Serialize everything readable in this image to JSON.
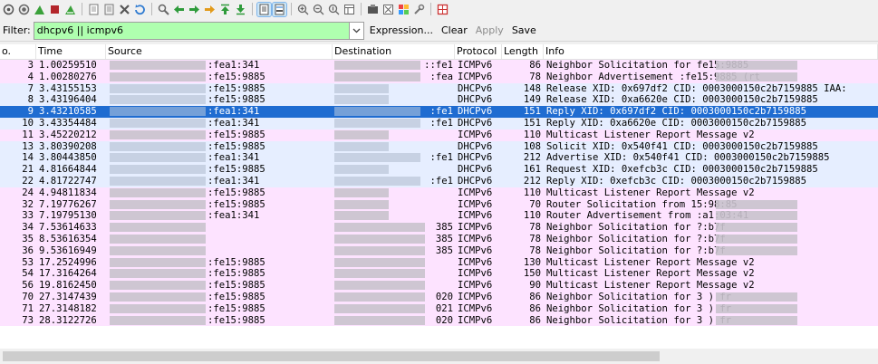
{
  "toolbar": {
    "icons": [
      "capture-options-icon",
      "restart-icon",
      "shark-fin-icon",
      "stop-icon",
      "shark-fin-reload-icon",
      "open-file-icon",
      "save-file-icon",
      "close-file-icon",
      "reload-icon",
      "find-icon",
      "go-back-icon",
      "go-forward-icon",
      "go-to-packet-icon",
      "go-first-icon",
      "go-last-icon",
      "autoscroll-icon",
      "colorize-icon",
      "zoom-in-icon",
      "zoom-out-icon",
      "zoom-normal-icon",
      "resize-columns-icon",
      "capture-filters-icon",
      "display-filters-icon",
      "coloring-rules-icon",
      "preferences-icon",
      "help-icon"
    ]
  },
  "filter": {
    "label": "Filter:",
    "value": "dhcpv6 || icmpv6",
    "expression": "Expression...",
    "clear": "Clear",
    "apply": "Apply",
    "save": "Save"
  },
  "columns": {
    "no": "o.",
    "time": "Time",
    "source": "Source",
    "destination": "Destination",
    "protocol": "Protocol",
    "length": "Length",
    "info": "Info"
  },
  "packets": [
    {
      "no": "3",
      "time": "1.00259510",
      "src": ":fea1:341",
      "dst": "::fe1",
      "proto": "ICMPv6",
      "len": "86",
      "info": "Neighbor Solicitation for                 fe15:9885",
      "color": "pink"
    },
    {
      "no": "4",
      "time": "1.00280276",
      "src": ":fe15:9885",
      "dst": ":fea",
      "proto": "ICMPv6",
      "len": "78",
      "info": "Neighbor Advertisement                   :fe15:9885 (rt",
      "color": "pink"
    },
    {
      "no": "7",
      "time": "3.43155153",
      "src": ":fe15:9885",
      "dst": "",
      "proto": "DHCPv6",
      "len": "148",
      "info": "Release XID: 0x697df2 CID: 0003000150c2b7159885 IAA:",
      "color": "blue"
    },
    {
      "no": "8",
      "time": "3.43196404",
      "src": ":fe15:9885",
      "dst": "",
      "proto": "DHCPv6",
      "len": "149",
      "info": "Release XID: 0xa6620e CID: 0003000150c2b7159885",
      "color": "blue"
    },
    {
      "no": "9",
      "time": "3.43210585",
      "src": ":fea1:341",
      "dst": ":fe1",
      "proto": "DHCPv6",
      "len": "151",
      "info": "Reply XID: 0x697df2 CID: 0003000150c2b7159885",
      "color": "sel"
    },
    {
      "no": "10",
      "time": "3.43354484",
      "src": ":fea1:341",
      "dst": ":fe1",
      "proto": "DHCPv6",
      "len": "151",
      "info": "Reply XID: 0xa6620e CID: 0003000150c2b7159885",
      "color": "blue"
    },
    {
      "no": "11",
      "time": "3.45220212",
      "src": ":fe15:9885",
      "dst": "",
      "proto": "ICMPv6",
      "len": "110",
      "info": "Multicast Listener Report Message v2",
      "color": "pink"
    },
    {
      "no": "13",
      "time": "3.80390208",
      "src": ":fe15:9885",
      "dst": "",
      "proto": "DHCPv6",
      "len": "108",
      "info": "Solicit XID: 0x540f41 CID: 0003000150c2b7159885",
      "color": "blue"
    },
    {
      "no": "14",
      "time": "3.80443850",
      "src": ":fea1:341",
      "dst": ":fe1",
      "proto": "DHCPv6",
      "len": "212",
      "info": "Advertise XID: 0x540f41 CID: 0003000150c2b7159885",
      "color": "blue"
    },
    {
      "no": "21",
      "time": "4.81664844",
      "src": ":fe15:9885",
      "dst": "",
      "proto": "DHCPv6",
      "len": "161",
      "info": "Request XID: 0xefcb3c CID: 0003000150c2b7159885",
      "color": "blue"
    },
    {
      "no": "22",
      "time": "4.81722747",
      "src": ":fea1:341",
      "dst": ":fe1",
      "proto": "DHCPv6",
      "len": "212",
      "info": "Reply XID: 0xefcb3c CID: 0003000150c2b7159885",
      "color": "blue"
    },
    {
      "no": "24",
      "time": "4.94811834",
      "src": ":fe15:9885",
      "dst": "",
      "proto": "ICMPv6",
      "len": "110",
      "info": "Multicast Listener Report Message v2",
      "color": "pink"
    },
    {
      "no": "32",
      "time": "7.19776267",
      "src": ":fe15:9885",
      "dst": "",
      "proto": "ICMPv6",
      "len": "70",
      "info": "Router Solicitation from           15:98:85",
      "color": "pink"
    },
    {
      "no": "33",
      "time": "7.19795130",
      "src": ":fea1:341",
      "dst": "",
      "proto": "ICMPv6",
      "len": "110",
      "info": "Router Advertisement from         :a1:03:41",
      "color": "pink"
    },
    {
      "no": "34",
      "time": "7.53614633",
      "src": "",
      "dst": "385",
      "proto": "ICMPv6",
      "len": "78",
      "info": "Neighbor Solicitation for                          ?:b7f",
      "color": "pink"
    },
    {
      "no": "35",
      "time": "8.53616354",
      "src": "",
      "dst": "385",
      "proto": "ICMPv6",
      "len": "78",
      "info": "Neighbor Solicitation for                          ?:b7f",
      "color": "pink"
    },
    {
      "no": "36",
      "time": "9.53616949",
      "src": "",
      "dst": "385",
      "proto": "ICMPv6",
      "len": "78",
      "info": "Neighbor Solicitation for                          ?:b7f",
      "color": "pink"
    },
    {
      "no": "53",
      "time": "17.2524996",
      "src": ":fe15:9885",
      "dst": "",
      "proto": "ICMPv6",
      "len": "130",
      "info": "Multicast Listener Report Message v2",
      "color": "pink"
    },
    {
      "no": "54",
      "time": "17.3164264",
      "src": ":fe15:9885",
      "dst": "",
      "proto": "ICMPv6",
      "len": "150",
      "info": "Multicast Listener Report Message v2",
      "color": "pink"
    },
    {
      "no": "56",
      "time": "19.8162450",
      "src": ":fe15:9885",
      "dst": "",
      "proto": "ICMPv6",
      "len": "90",
      "info": "Multicast Listener Report Message v2",
      "color": "pink"
    },
    {
      "no": "70",
      "time": "27.3147439",
      "src": ":fe15:9885",
      "dst": "020",
      "proto": "ICMPv6",
      "len": "86",
      "info": "Neighbor Solicitation for 3                      ) fr",
      "color": "pink"
    },
    {
      "no": "71",
      "time": "27.3148182",
      "src": ":fe15:9885",
      "dst": "021",
      "proto": "ICMPv6",
      "len": "86",
      "info": "Neighbor Solicitation for 3                      ) fr",
      "color": "pink"
    },
    {
      "no": "73",
      "time": "28.3122726",
      "src": ":fe15:9885",
      "dst": "020",
      "proto": "ICMPv6",
      "len": "86",
      "info": "Neighbor Solicitation for 3                      ) fr",
      "color": "pink"
    }
  ]
}
